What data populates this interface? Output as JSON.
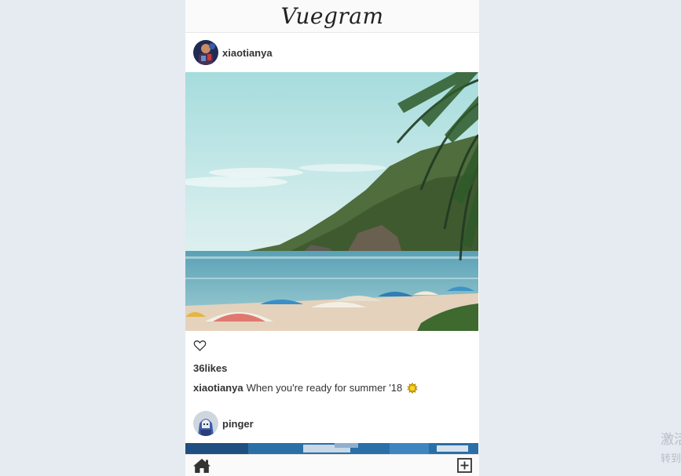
{
  "app": {
    "logo": "Vuegram"
  },
  "posts": [
    {
      "username": "xiaotianya",
      "likes_text": "36likes",
      "caption_user": "xiaotianya",
      "caption_text": "When you're ready for summer '18",
      "image_desc": "beach with umbrellas, palm fronds and green hillside"
    },
    {
      "username": "pinger"
    }
  ],
  "footer": {
    "home_icon": "home-icon",
    "add_icon": "plus-square-icon"
  },
  "watermark": {
    "line1": "激活",
    "line2": "转到"
  },
  "colors": {
    "page_background": "#e6eaf1",
    "text": "#333333"
  }
}
